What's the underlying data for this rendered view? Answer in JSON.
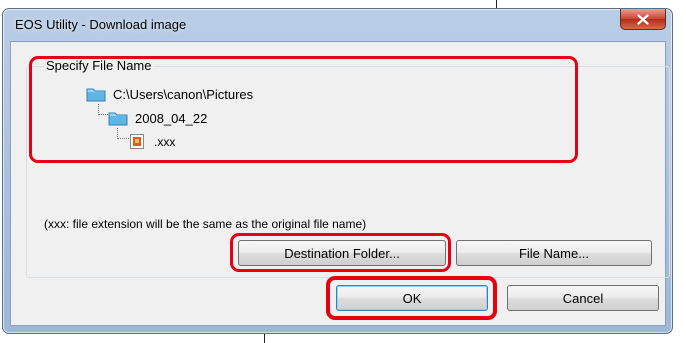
{
  "window": {
    "title": "EOS Utility - Download image"
  },
  "group": {
    "label": "Specify File Name"
  },
  "tree": {
    "root_path": "C:\\Users\\canon\\Pictures",
    "subfolder": "2008_04_22",
    "file": ".xxx"
  },
  "note": "(xxx: file extension will be the same as the original file name)",
  "buttons": {
    "destination_folder": "Destination Folder...",
    "file_name": "File Name...",
    "ok": "OK",
    "cancel": "Cancel"
  },
  "icons": {
    "folder": "folder-icon",
    "image_file": "image-file-icon",
    "close": "close-icon"
  },
  "colors": {
    "highlight": "#e60012",
    "folder": "#5fb0e0"
  }
}
